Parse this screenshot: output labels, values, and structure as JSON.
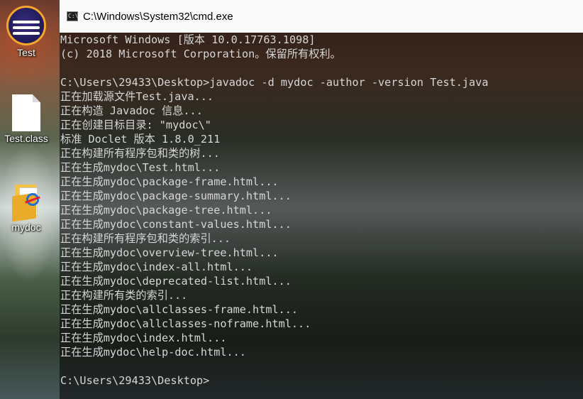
{
  "desktop": {
    "icons": [
      {
        "label": "Test",
        "icon": "eclipse-icon"
      },
      {
        "label": "Test.class",
        "icon": "file-icon"
      },
      {
        "label": "mydoc",
        "icon": "html-folder-icon"
      }
    ]
  },
  "window": {
    "title": "C:\\Windows\\System32\\cmd.exe",
    "icon": "cmd-icon",
    "lines": [
      "Microsoft Windows [版本 10.0.17763.1098]",
      "(c) 2018 Microsoft Corporation。保留所有权利。",
      "",
      "C:\\Users\\29433\\Desktop>javadoc -d mydoc -author -version Test.java",
      "正在加载源文件Test.java...",
      "正在构造 Javadoc 信息...",
      "正在创建目标目录: \"mydoc\\\"",
      "标准 Doclet 版本 1.8.0_211",
      "正在构建所有程序包和类的树...",
      "正在生成mydoc\\Test.html...",
      "正在生成mydoc\\package-frame.html...",
      "正在生成mydoc\\package-summary.html...",
      "正在生成mydoc\\package-tree.html...",
      "正在生成mydoc\\constant-values.html...",
      "正在构建所有程序包和类的索引...",
      "正在生成mydoc\\overview-tree.html...",
      "正在生成mydoc\\index-all.html...",
      "正在生成mydoc\\deprecated-list.html...",
      "正在构建所有类的索引...",
      "正在生成mydoc\\allclasses-frame.html...",
      "正在生成mydoc\\allclasses-noframe.html...",
      "正在生成mydoc\\index.html...",
      "正在生成mydoc\\help-doc.html...",
      "",
      "C:\\Users\\29433\\Desktop>"
    ]
  },
  "colors": {
    "console_text": "#d6d6d6",
    "titlebar_bg": "#fafafa"
  }
}
